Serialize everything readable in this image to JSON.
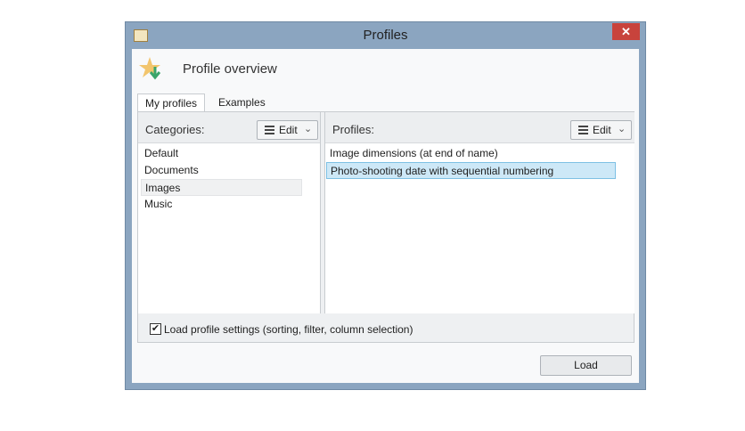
{
  "window": {
    "title": "Profiles",
    "close_icon": "close-icon"
  },
  "header": {
    "title": "Profile overview"
  },
  "tabs": [
    {
      "label": "My profiles",
      "active": true
    },
    {
      "label": "Examples",
      "active": false
    }
  ],
  "categories": {
    "label": "Categories:",
    "edit_label": "Edit",
    "items": [
      "Default",
      "Documents",
      "Images",
      "Music"
    ],
    "selected": "Images"
  },
  "profiles": {
    "label": "Profiles:",
    "edit_label": "Edit",
    "items": [
      "Image dimensions (at end of name)",
      "Photo-shooting date with sequential numbering"
    ],
    "selected": "Photo-shooting date with sequential numbering"
  },
  "options": {
    "load_settings_label": "Load profile settings (sorting, filter, column selection)",
    "load_settings_checked": true
  },
  "footer": {
    "load_label": "Load"
  },
  "colors": {
    "titlebar": "#8ba5c0",
    "close": "#c8433c",
    "selection": "#cde8f7"
  }
}
